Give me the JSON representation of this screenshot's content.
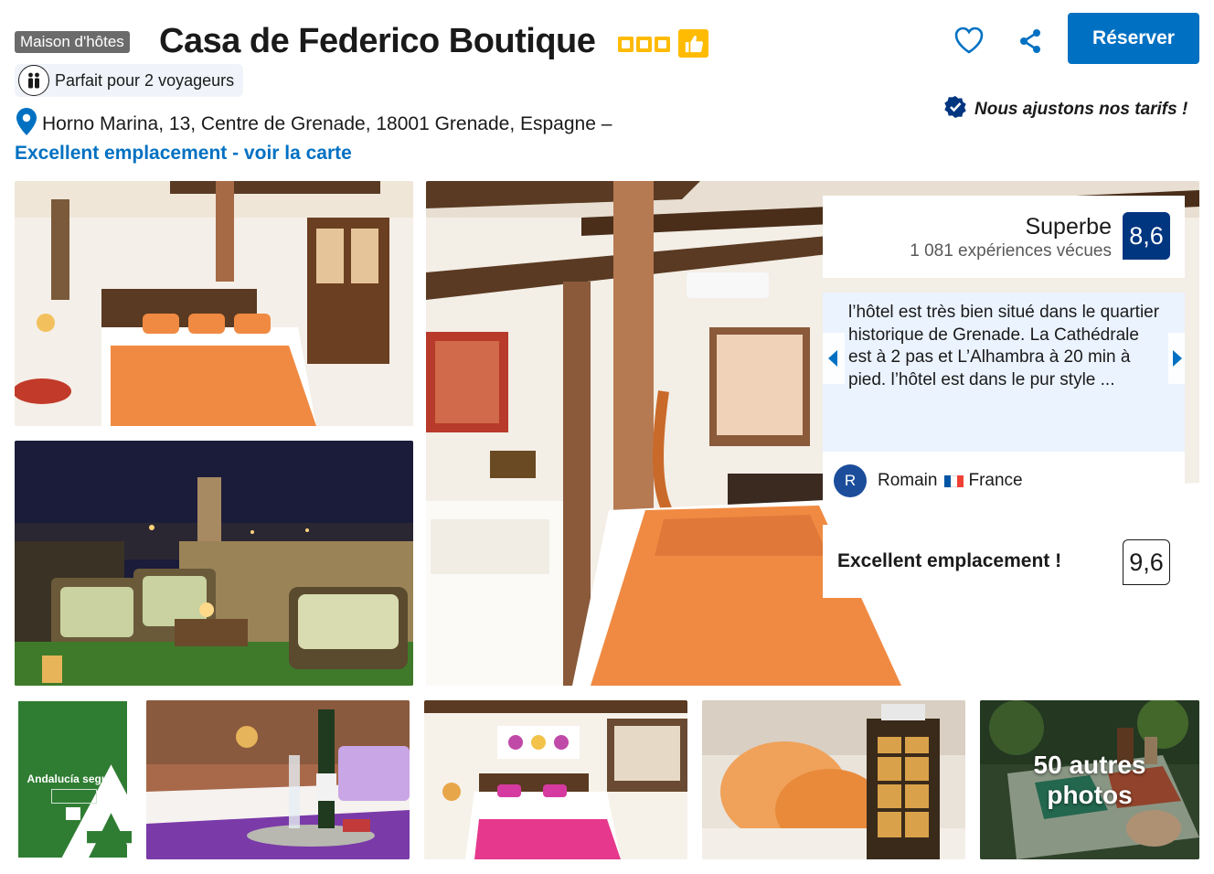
{
  "header": {
    "property_type": "Maison d'hôtes",
    "title": "Casa de Federico Boutique",
    "star_rating": 3,
    "star_color": "#febb02",
    "travelers_label": "Parfait pour 2 voyageurs",
    "address": "Horno Marina, 13, Centre de Grenade, 18001 Grenade, Espagne –",
    "map_link": "Excellent emplacement - voir la carte"
  },
  "actions": {
    "favorite_icon": "heart-icon",
    "share_icon": "share-icon",
    "reserve_label": "Réserver",
    "price_match": "Nous ajustons nos tarifs !"
  },
  "colors": {
    "primary": "#0071c2",
    "score_bg": "#003580",
    "review_bg": "#ebf3ff"
  },
  "review_panel": {
    "rating_word": "Superbe",
    "rating_count": "1 081 expériences vécues",
    "score": "8,6",
    "review_text": "l’hôtel est très bien situé dans le quartier historique de Grenade. La Cathédrale est à 2 pas et L’Alhambra à 20 min à pied. l’hôtel est dans le pur style ...",
    "reviewer_initial": "R",
    "reviewer_name": "Romain",
    "reviewer_country": "France",
    "location_label": "Excellent emplacement !",
    "location_score": "9,6"
  },
  "gallery": {
    "badge_text": "Andalucía segura",
    "more_photos_label": "50 autres photos"
  }
}
